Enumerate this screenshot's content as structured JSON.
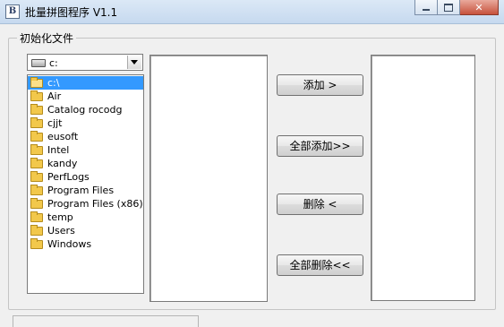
{
  "window": {
    "icon_letter": "B",
    "title": "批量拼图程序 V1.1",
    "close_glyph": "✕"
  },
  "group": {
    "label": "初始化文件"
  },
  "drive": {
    "value": "c:"
  },
  "directories": [
    {
      "label": "c:\\",
      "selected": true,
      "open": true
    },
    {
      "label": "Air"
    },
    {
      "label": "Catalog rocodg"
    },
    {
      "label": "cjjt"
    },
    {
      "label": "eusoft"
    },
    {
      "label": "Intel"
    },
    {
      "label": "kandy"
    },
    {
      "label": "PerfLogs"
    },
    {
      "label": "Program Files"
    },
    {
      "label": "Program Files (x86)"
    },
    {
      "label": "temp"
    },
    {
      "label": "Users"
    },
    {
      "label": "Windows"
    }
  ],
  "buttons": {
    "add": "添加 >",
    "add_all": "全部添加>>",
    "remove": "删除 <",
    "remove_all": "全部删除<<"
  },
  "source_files": [],
  "selected_files": []
}
